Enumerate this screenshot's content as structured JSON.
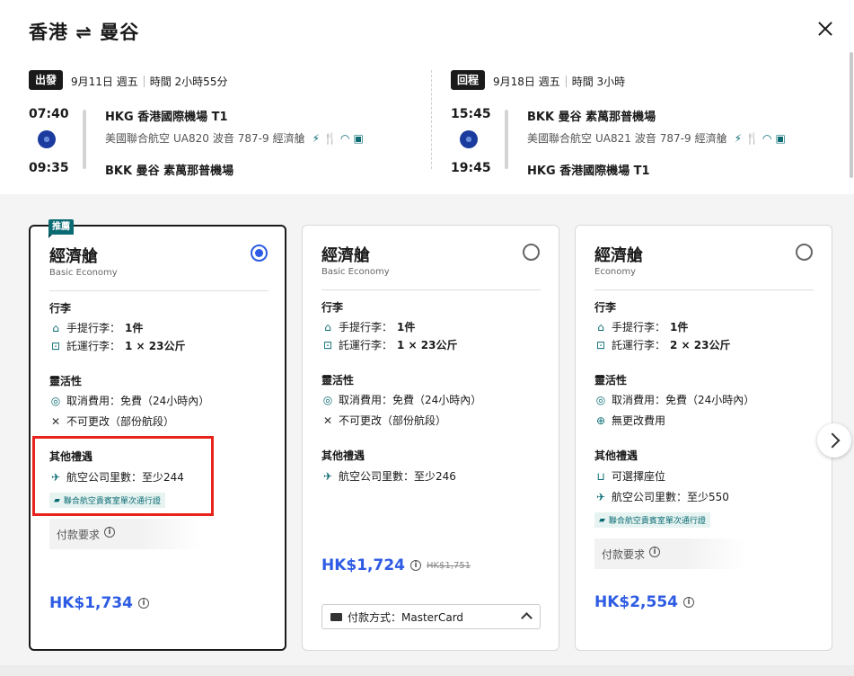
{
  "header": {
    "title": "香港 ⇌ 曼谷"
  },
  "outbound": {
    "tag": "出發",
    "date": "9月11日 週五",
    "duration": "時間 2小時55分",
    "dep_time": "07:40",
    "arr_time": "09:35",
    "dep_airport": "HKG 香港國際機場 T1",
    "arr_airport": "BKK 曼谷 素萬那普機場",
    "airline": "美國聯合航空",
    "flight_no": "UA820",
    "aircraft": "波音 787-9",
    "cabin": "經濟艙"
  },
  "inbound": {
    "tag": "回程",
    "date": "9月18日 週五",
    "duration": "時間 3小時",
    "dep_time": "15:45",
    "arr_time": "19:45",
    "dep_airport": "BKK 曼谷 素萬那普機場",
    "arr_airport": "HKG 香港國際機場 T1",
    "airline": "美國聯合航空",
    "flight_no": "UA821",
    "aircraft": "波音 787-9",
    "cabin": "經濟艙"
  },
  "fares": [
    {
      "badge": "推薦",
      "cabin": "經濟艙",
      "subcabin": "Basic Economy",
      "baggage_title": "行李",
      "carry_on_label": "手提行李：",
      "carry_on_value": "1件",
      "checked_label": "託運行李：",
      "checked_value": "1 × 23公斤",
      "flex_title": "靈活性",
      "cancel": "取消費用：免費（24小時內）",
      "change": "不可更改（部份航段）",
      "perks_title": "其他禮遇",
      "miles": "航空公司里數：至少244",
      "lounge_pass": "聯合航空貴賓室單次通行證",
      "pay_req": "付款要求",
      "price": "HK$1,734"
    },
    {
      "cabin": "經濟艙",
      "subcabin": "Basic Economy",
      "baggage_title": "行李",
      "carry_on_label": "手提行李：",
      "carry_on_value": "1件",
      "checked_label": "託運行李：",
      "checked_value": "1 × 23公斤",
      "flex_title": "靈活性",
      "cancel": "取消費用：免費（24小時內）",
      "change": "不可更改（部份航段）",
      "perks_title": "其他禮遇",
      "miles": "航空公司里數：至少246",
      "price": "HK$1,724",
      "old_price": "HK$1,751",
      "payment_method": "付款方式：MasterCard"
    },
    {
      "cabin": "經濟艙",
      "subcabin": "Economy",
      "baggage_title": "行李",
      "carry_on_label": "手提行李：",
      "carry_on_value": "1件",
      "checked_label": "託運行李：",
      "checked_value": "2 × 23公斤",
      "flex_title": "靈活性",
      "cancel": "取消費用：免費（24小時內）",
      "change": "無更改費用",
      "perks_title": "其他禮遇",
      "seat": "可選擇座位",
      "miles": "航空公司里數：至少550",
      "lounge_pass": "聯合航空貴賓室單次通行證",
      "pay_req": "付款要求",
      "price": "HK$2,554"
    }
  ],
  "colors": {
    "accent": "#2d5be3",
    "teal": "#0a6b73",
    "highlight": "#e8231b"
  }
}
